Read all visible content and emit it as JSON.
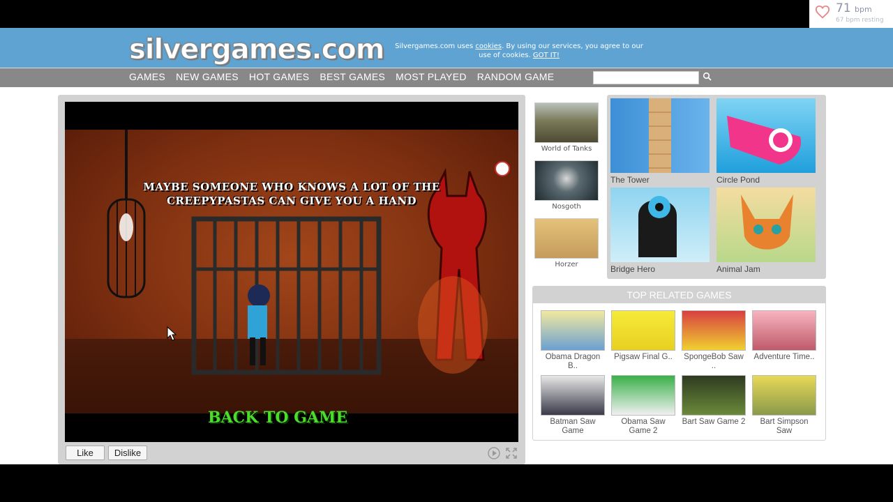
{
  "heart_rate": {
    "bpm": "71",
    "unit": "bpm",
    "resting": "67 bpm resting"
  },
  "header": {
    "logo": "silvergames.com",
    "cookie_pre": "Silvergames.com uses ",
    "cookie_link": "cookies",
    "cookie_post": ". By using our services, you agree to our use of cookies.",
    "cookie_ok": "GOT IT!"
  },
  "nav": {
    "items": [
      "GAMES",
      "NEW GAMES",
      "HOT GAMES",
      "BEST GAMES",
      "MOST PLAYED",
      "RANDOM GAME"
    ],
    "search_value": ""
  },
  "game": {
    "caption": "MAYBE SOMEONE WHO KNOWS A LOT OF THE CREEPYPASTAS CAN GIVE YOU A HAND",
    "back_button": "BACK TO GAME",
    "like": "Like",
    "dislike": "Dislike"
  },
  "side_games": [
    {
      "label": "World of Tanks",
      "color": "#6c6a4e"
    },
    {
      "label": "Nosgoth",
      "color": "#2f3d44"
    },
    {
      "label": "Horzer",
      "color": "#c49b5c"
    }
  ],
  "featured": [
    {
      "label": "The Tower",
      "color": "#4e9de0"
    },
    {
      "label": "Circle Pond",
      "color": "#35b4e8"
    },
    {
      "label": "Bridge Hero",
      "color": "#8cd2ee"
    },
    {
      "label": "Animal Jam",
      "color": "#e08a3a"
    }
  ],
  "related": {
    "title": "TOP RELATED GAMES",
    "items": [
      {
        "label": "Obama Dragon B..",
        "color": "#d8c86a"
      },
      {
        "label": "Pigsaw Final G..",
        "color": "#f0e040"
      },
      {
        "label": "SpongeBob Saw ..",
        "color": "#e8c020"
      },
      {
        "label": "Adventure Time..",
        "color": "#e07080"
      },
      {
        "label": "Batman Saw Game",
        "color": "#6a6a7a"
      },
      {
        "label": "Obama Saw Game 2",
        "color": "#3ab04a"
      },
      {
        "label": "Bart Saw Game 2",
        "color": "#556b2f"
      },
      {
        "label": "Bart Simpson Saw",
        "color": "#d8d040"
      }
    ]
  }
}
